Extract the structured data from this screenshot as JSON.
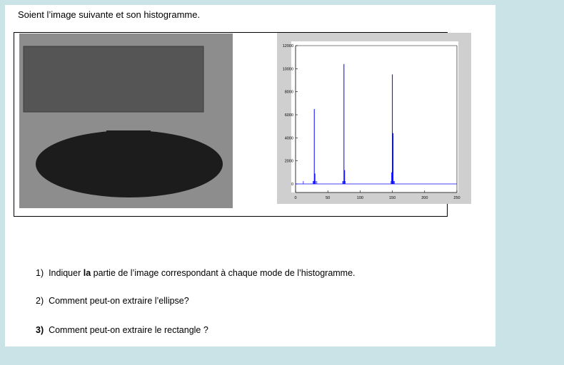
{
  "document": {
    "heading": "Soient l’image suivante et son histogramme.",
    "questions": [
      {
        "number": "1)",
        "number_bold": false,
        "lead_plain": "Indiquer ",
        "lead_bold": "la",
        "text": " partie de l’image correspondant à chaque mode de l’histogramme."
      },
      {
        "number": "2)",
        "number_bold": false,
        "lead_plain": "",
        "lead_bold": "",
        "text": "Comment peut-on extraire l’ellipse?"
      },
      {
        "number": "3)",
        "number_bold": true,
        "lead_plain": "",
        "lead_bold": "",
        "text": "Comment peut-on extraire le rectangle ?"
      }
    ]
  },
  "image": {
    "background_color": "#8d8d8d",
    "rectangle_color": "#555555",
    "ellipse_color": "#1c1c1c"
  },
  "chart_data": {
    "type": "line",
    "title": "",
    "xlabel": "",
    "ylabel": "",
    "xlim": [
      0,
      250
    ],
    "ylim": [
      0,
      12000
    ],
    "x_ticks": [
      0,
      50,
      100,
      150,
      200,
      250
    ],
    "y_ticks": [
      0,
      2000,
      4000,
      6000,
      8000,
      10000,
      12000
    ],
    "grid": false,
    "line_color": "#0000ff",
    "peaks": [
      {
        "x": 29,
        "y": 6500
      },
      {
        "x": 75,
        "y": 10400
      },
      {
        "x": 150,
        "y": 9500
      }
    ],
    "minor_peaks": [
      {
        "x": 30,
        "y": 900
      },
      {
        "x": 76,
        "y": 1200
      },
      {
        "x": 149,
        "y": 1000
      },
      {
        "x": 151,
        "y": 4400
      }
    ]
  }
}
